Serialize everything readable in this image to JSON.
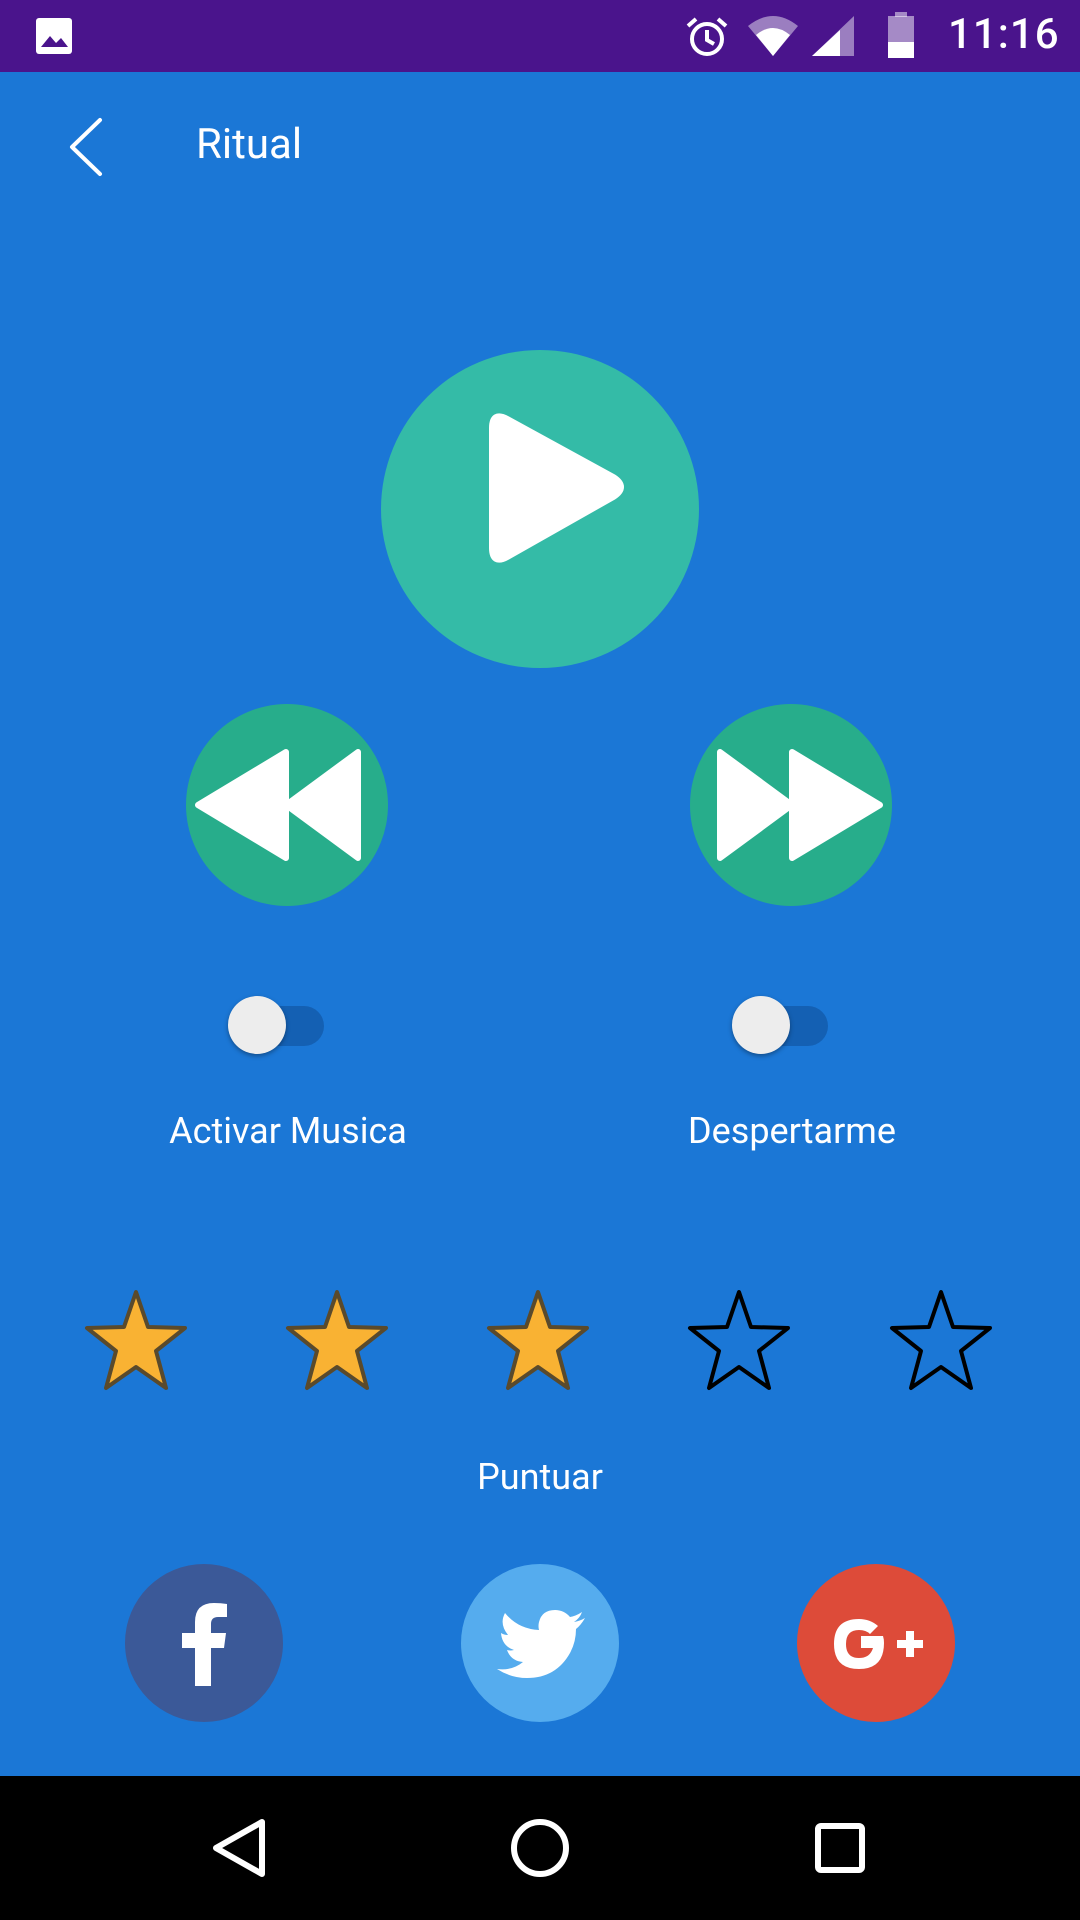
{
  "status_bar": {
    "time": "11:16",
    "icons": [
      "gallery-icon",
      "alarm-icon",
      "wifi-icon",
      "signal-icon",
      "battery-icon"
    ],
    "color": "#4A148C"
  },
  "app_bar": {
    "title": "Ritual",
    "back_icon": "chevron-left-icon"
  },
  "player": {
    "play_icon": "play-icon",
    "rewind_icon": "rewind-icon",
    "fast_forward_icon": "fast-forward-icon",
    "primary_color": "#34BBA7",
    "secondary_color": "#27AD8B"
  },
  "toggles": [
    {
      "label": "Activar Musica",
      "on": false
    },
    {
      "label": "Despertarme",
      "on": false
    }
  ],
  "rating": {
    "label": "Puntuar",
    "value": 3,
    "max": 5,
    "filled_color": "#F9B233"
  },
  "social": [
    {
      "name": "facebook",
      "icon": "facebook-icon",
      "color": "#3B5998"
    },
    {
      "name": "twitter",
      "icon": "twitter-icon",
      "color": "#55ACEE"
    },
    {
      "name": "google-plus",
      "icon": "google-plus-icon",
      "color": "#DD4B39"
    }
  ],
  "nav_bar": {
    "icons": [
      "back-triangle-icon",
      "home-circle-icon",
      "recents-square-icon"
    ]
  },
  "theme": {
    "background": "#1B77D6"
  }
}
